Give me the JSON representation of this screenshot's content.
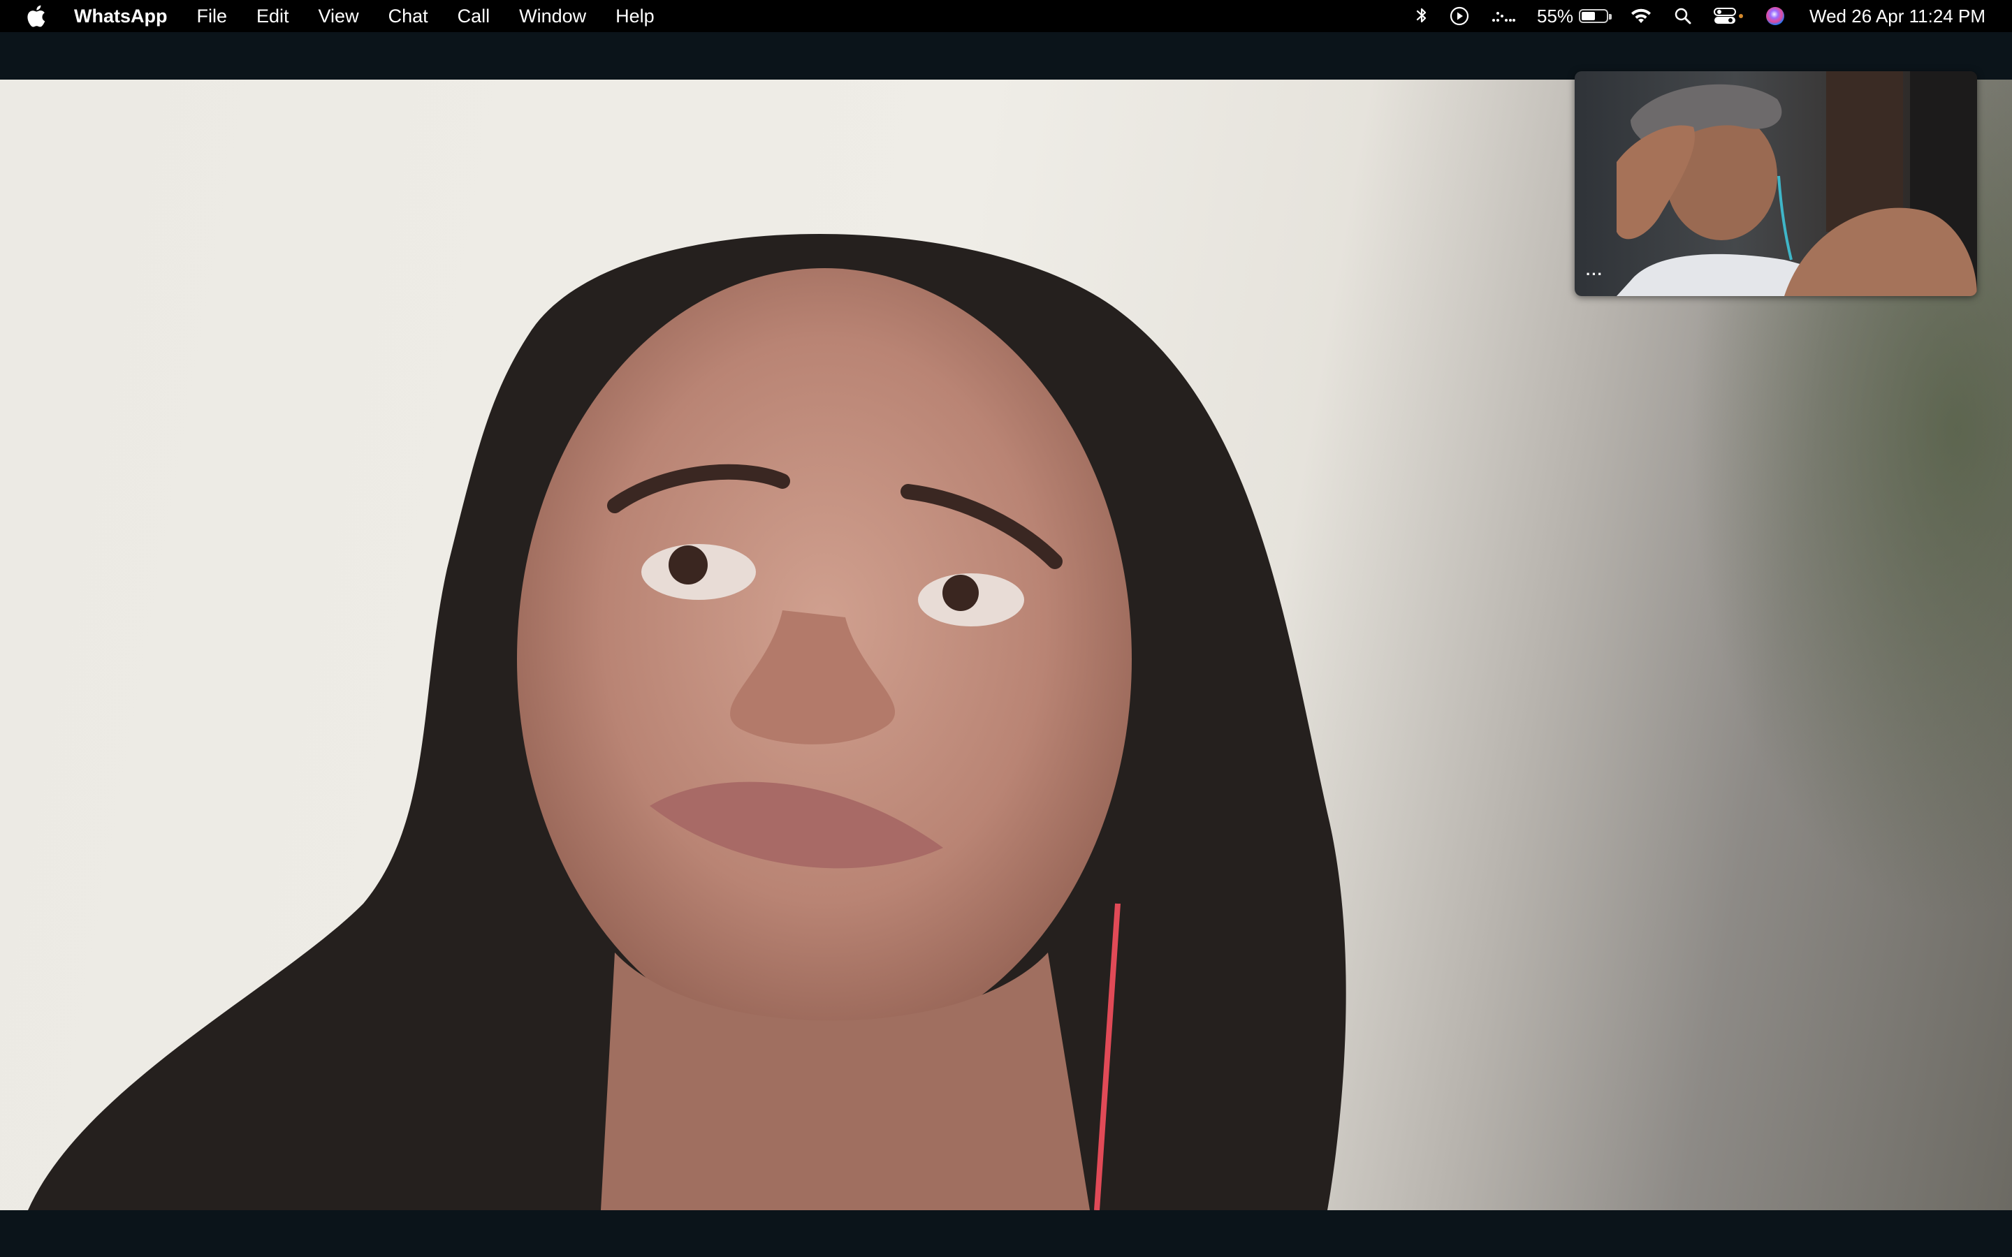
{
  "menubar": {
    "apple_icon": "apple-logo-icon",
    "app_name": "WhatsApp",
    "menus": [
      "File",
      "Edit",
      "View",
      "Chat",
      "Call",
      "Window",
      "Help"
    ],
    "status_icons": [
      "bluetooth-icon",
      "now-playing-icon",
      "focus-icon",
      "battery-icon",
      "wifi-icon",
      "spotlight-search-icon",
      "control-center-icon",
      "siri-icon"
    ],
    "battery_percent_label": "55%",
    "battery_level": 0.55,
    "datetime": "Wed 26 Apr  11:24 PM"
  },
  "call": {
    "remote_video": "remote-participant-video",
    "self_preview": "self-camera-preview",
    "self_preview_options": "···"
  },
  "colors": {
    "menubar_bg": "#000000",
    "window_bg": "#0b141a"
  }
}
